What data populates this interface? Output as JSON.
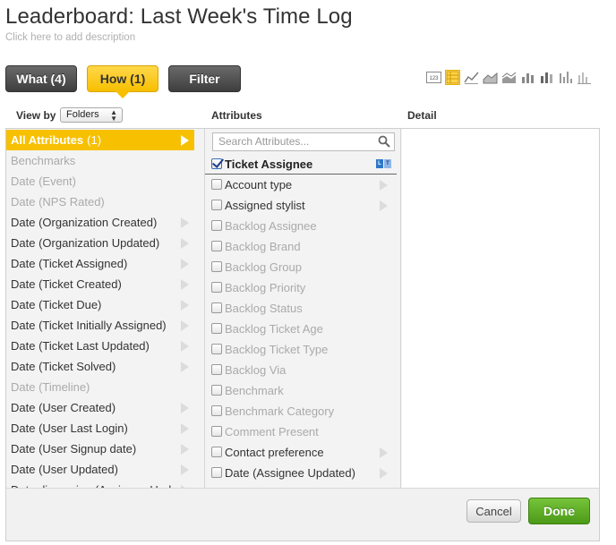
{
  "header": {
    "title": "Leaderboard: Last Week's Time Log",
    "description_placeholder": "Click here to add description"
  },
  "tabs": [
    {
      "label": "What (4)",
      "active": false
    },
    {
      "label": "How (1)",
      "active": true
    },
    {
      "label": "Filter",
      "active": false
    }
  ],
  "viz_icons": {
    "number_label": "123",
    "items": [
      "number-icon",
      "table-icon",
      "line-chart-icon",
      "area-chart-icon",
      "stacked-area-icon",
      "bar-chart-icon",
      "stacked-bar-icon",
      "column-chart-icon",
      "column-stacked-icon"
    ],
    "active": "table-icon"
  },
  "columns": {
    "view_by_label": "View by",
    "view_by_value": "Folders",
    "attributes_label": "Attributes",
    "detail_label": "Detail"
  },
  "folders": [
    {
      "label": "All Attributes",
      "count": "(1)",
      "selected": true,
      "dim": false,
      "arrow": true
    },
    {
      "label": "Benchmarks",
      "dim": true,
      "arrow": false
    },
    {
      "label": "Date (Event)",
      "dim": true,
      "arrow": false
    },
    {
      "label": "Date (NPS Rated)",
      "dim": true,
      "arrow": false
    },
    {
      "label": "Date (Organization Created)",
      "dim": false,
      "arrow": true
    },
    {
      "label": "Date (Organization Updated)",
      "dim": false,
      "arrow": true
    },
    {
      "label": "Date (Ticket Assigned)",
      "dim": false,
      "arrow": true
    },
    {
      "label": "Date (Ticket Created)",
      "dim": false,
      "arrow": true
    },
    {
      "label": "Date (Ticket Due)",
      "dim": false,
      "arrow": true
    },
    {
      "label": "Date (Ticket Initially Assigned)",
      "dim": false,
      "arrow": true
    },
    {
      "label": "Date (Ticket Last Updated)",
      "dim": false,
      "arrow": true
    },
    {
      "label": "Date (Ticket Solved)",
      "dim": false,
      "arrow": true
    },
    {
      "label": "Date (Timeline)",
      "dim": true,
      "arrow": false
    },
    {
      "label": "Date (User Created)",
      "dim": false,
      "arrow": true
    },
    {
      "label": "Date (User Last Login)",
      "dim": false,
      "arrow": true
    },
    {
      "label": "Date (User Signup date)",
      "dim": false,
      "arrow": true
    },
    {
      "label": "Date (User Updated)",
      "dim": false,
      "arrow": true
    },
    {
      "label": "Date dimension (Assignee Upd",
      "dim": false,
      "arrow": true
    }
  ],
  "attributes": {
    "search_placeholder": "Search Attributes...",
    "items": [
      {
        "label": "Ticket Assignee",
        "checked": true,
        "dim": false,
        "arrow": false,
        "badge": true
      },
      {
        "label": "Account type",
        "checked": false,
        "dim": false,
        "arrow": true
      },
      {
        "label": "Assigned stylist",
        "checked": false,
        "dim": false,
        "arrow": true
      },
      {
        "label": "Backlog Assignee",
        "checked": false,
        "dim": true,
        "arrow": false
      },
      {
        "label": "Backlog Brand",
        "checked": false,
        "dim": true,
        "arrow": false
      },
      {
        "label": "Backlog Group",
        "checked": false,
        "dim": true,
        "arrow": false
      },
      {
        "label": "Backlog Priority",
        "checked": false,
        "dim": true,
        "arrow": false
      },
      {
        "label": "Backlog Status",
        "checked": false,
        "dim": true,
        "arrow": false
      },
      {
        "label": "Backlog Ticket Age",
        "checked": false,
        "dim": true,
        "arrow": false
      },
      {
        "label": "Backlog Ticket Type",
        "checked": false,
        "dim": true,
        "arrow": false
      },
      {
        "label": "Backlog Via",
        "checked": false,
        "dim": true,
        "arrow": false
      },
      {
        "label": "Benchmark",
        "checked": false,
        "dim": true,
        "arrow": false
      },
      {
        "label": "Benchmark Category",
        "checked": false,
        "dim": true,
        "arrow": false
      },
      {
        "label": "Comment Present",
        "checked": false,
        "dim": true,
        "arrow": false
      },
      {
        "label": "Contact preference",
        "checked": false,
        "dim": false,
        "arrow": true
      },
      {
        "label": "Date (Assignee Updated)",
        "checked": false,
        "dim": false,
        "arrow": true
      }
    ],
    "badge_l": "L",
    "badge_t": "T"
  },
  "footer": {
    "cancel_label": "Cancel",
    "done_label": "Done"
  },
  "colors": {
    "accent_yellow": "#f7c000",
    "done_green": "#5aa820",
    "dark_button": "#4a4a4a"
  }
}
